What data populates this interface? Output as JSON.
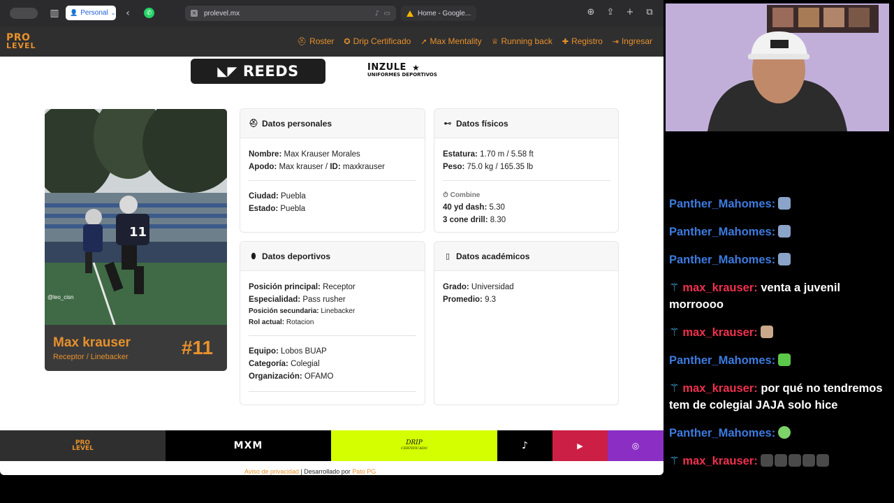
{
  "browser": {
    "profile_label": "Personal",
    "tab_active_title": "prolevel.mx",
    "tab_other_title": "Home - Google..."
  },
  "site": {
    "logo_top": "PRO",
    "logo_bottom": "LEVEL",
    "accent_color": "#e8912b",
    "nav": [
      {
        "label": "Roster",
        "icon": "helmet-icon"
      },
      {
        "label": "Drip Certificado",
        "icon": "badge-icon"
      },
      {
        "label": "Max Mentality",
        "icon": "rocket-icon"
      },
      {
        "label": "Running back",
        "icon": "trophy-icon"
      },
      {
        "label": "Registro",
        "icon": "user-plus-icon"
      },
      {
        "label": "Ingresar",
        "icon": "login-icon"
      }
    ],
    "sponsors": {
      "reeds": "REEDS",
      "inzule_top": "INZULE",
      "inzule_bottom": "UNIFORMES DEPORTIVOS"
    }
  },
  "player": {
    "name": "Max krauser",
    "position": "Receptor / Linebacker",
    "number": "#11",
    "photo_credit": "@leo_cisn"
  },
  "personal": {
    "title": "Datos personales",
    "nombre_label": "Nombre:",
    "nombre": "Max Krauser Morales",
    "apodo_label": "Apodo:",
    "apodo": "Max krauser /",
    "id_label": "ID:",
    "id": "maxkrauser",
    "ciudad_label": "Ciudad:",
    "ciudad": "Puebla",
    "estado_label": "Estado:",
    "estado": "Puebla"
  },
  "fisicos": {
    "title": "Datos físicos",
    "estatura_label": "Estatura:",
    "estatura": "1.70 m / 5.58 ft",
    "peso_label": "Peso:",
    "peso": "75.0 kg / 165.35 lb",
    "combine_label": "Combine",
    "dash_label": "40 yd dash:",
    "dash": "5.30",
    "cone_label": "3 cone drill:",
    "cone": "8.30"
  },
  "deportivos": {
    "title": "Datos deportivos",
    "pos_label": "Posición principal:",
    "pos": "Receptor",
    "esp_label": "Especialidad:",
    "esp": "Pass rusher",
    "pos2_label": "Posición secundaria:",
    "pos2": "Linebacker",
    "rol_label": "Rol actual:",
    "rol": "Rotacion",
    "equipo_label": "Equipo:",
    "equipo": "Lobos BUAP",
    "cat_label": "Categoría:",
    "cat": "Colegial",
    "org_label": "Organización:",
    "org": "OFAMO"
  },
  "academicos": {
    "title": "Datos académicos",
    "grado_label": "Grado:",
    "grado": "Universidad",
    "prom_label": "Promedio:",
    "prom": "9.3"
  },
  "footer": {
    "pro_top": "PRO",
    "pro_bottom": "LEVEL",
    "mxm": "MXM",
    "drip_top": "DRIP",
    "drip_bottom": "CERTIFICADO",
    "privacy": "Aviso de privacidad",
    "dev_text": " | Desarrollado por ",
    "dev_name": "Pato                PG"
  },
  "chat": [
    {
      "user": "Panther_Mahomes:",
      "color": "#3d7be0",
      "wand": false,
      "text": "",
      "emotes": [
        "#8aa3c8"
      ]
    },
    {
      "user": "Panther_Mahomes:",
      "color": "#3d7be0",
      "wand": false,
      "text": "",
      "emotes": [
        "#8aa3c8"
      ]
    },
    {
      "user": "Panther_Mahomes:",
      "color": "#3d7be0",
      "wand": false,
      "text": "",
      "emotes": [
        "#8aa3c8"
      ]
    },
    {
      "user": "max_krauser:",
      "color": "#f0304e",
      "wand": true,
      "text": "venta a juvenil morroooo",
      "emotes": []
    },
    {
      "user": "max_krauser:",
      "color": "#f0304e",
      "wand": true,
      "text": "",
      "emotes": [
        "#c9a98a"
      ]
    },
    {
      "user": "Panther_Mahomes:",
      "color": "#3d7be0",
      "wand": false,
      "text": "",
      "emotes": [
        "#5cc84a"
      ]
    },
    {
      "user": "max_krauser:",
      "color": "#f0304e",
      "wand": true,
      "text": "por qué no tendremos tem de colegial JAJA solo hice",
      "emotes": []
    },
    {
      "user": "Panther_Mahomes:",
      "color": "#3d7be0",
      "wand": false,
      "text": "",
      "emotes": [
        "#7bd36a"
      ]
    },
    {
      "user": "max_krauser:",
      "color": "#f0304e",
      "wand": true,
      "text": "",
      "emotes": [
        "#4a4a4a",
        "#4a4a4a",
        "#4a4a4a",
        "#4a4a4a",
        "#4a4a4a"
      ]
    }
  ]
}
